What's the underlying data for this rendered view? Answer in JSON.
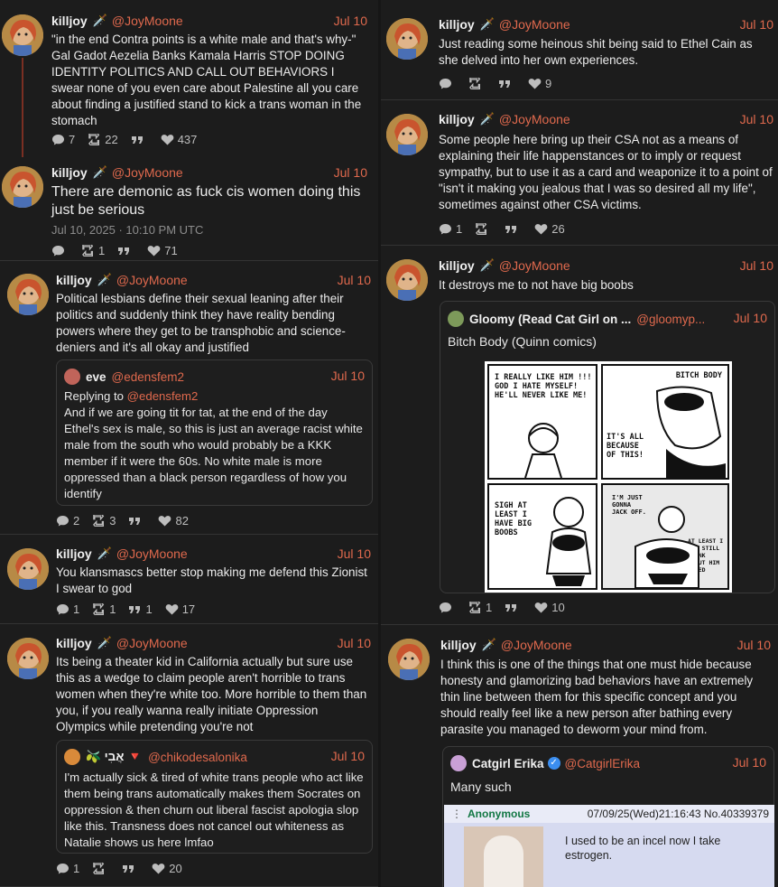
{
  "user": {
    "name": "killjoy",
    "handle": "@JoyMoone",
    "sword": "🗡️"
  },
  "left": {
    "p1": {
      "date": "Jul 10",
      "text": "\"in the end Contra points is a white male and that's why-\" Gal Gadot Aezelia Banks Kamala Harris STOP DOING IDENTITY POLITICS AND CALL OUT BEHAVIORS I swear none of you even care about Palestine all you care about finding a justified stand to kick a trans woman in the stomach",
      "replies": "7",
      "reposts": "22",
      "quotes": "",
      "likes": "437"
    },
    "p2": {
      "date": "Jul 10",
      "text": "There are demonic as fuck cis women doing this just be serious",
      "timestamp": "Jul 10, 2025 · 10:10 PM UTC",
      "replies": "",
      "reposts": "1",
      "quotes": "",
      "likes": "71"
    },
    "p3": {
      "date": "Jul 10",
      "text": "Political lesbians define their sexual leaning after their politics and suddenly think they have reality bending powers where they get to be transphobic and science-deniers and it's all okay and justified",
      "quote": {
        "name": "eve",
        "handle": "@edensfem2",
        "date": "Jul 10",
        "replying_label": "Replying to",
        "replying_to": "@edensfem2",
        "text": "And if we are going tit for tat, at the end of the day Ethel's sex is male, so this is just an average racist white male from the south who would probably be a KKK member if it were the 60s. No white male is more oppressed than a black person regardless of how you identify"
      },
      "replies": "2",
      "reposts": "3",
      "quotes": "",
      "likes": "82"
    },
    "p4": {
      "date": "Jul 10",
      "text": "You klansmascs better stop making me defend this Zionist I swear to god",
      "replies": "1",
      "reposts": "1",
      "quotes": "1",
      "likes": "17"
    },
    "p5": {
      "date": "Jul 10",
      "text": "Its being a theater kid in California actually but sure use this as a wedge to claim people aren't horrible to trans women when they're white too. More horrible to them than you, if you really wanna really initiate Oppression Olympics while pretending you're not",
      "quote": {
        "name": "🫒 אֲבִי 🔻",
        "handle": "@chikodesalonika",
        "date": "Jul 10",
        "text": "I'm actually sick & tired of white trans people who act like them being trans automatically makes them Socrates on oppression & then churn out liberal fascist apologia slop like this. Transness does not cancel out whiteness as Natalie shows us here lmfao"
      },
      "replies": "1",
      "reposts": "",
      "quotes": "",
      "likes": "20"
    }
  },
  "right": {
    "p1": {
      "date": "Jul 10",
      "text": "Just reading some heinous shit being said to Ethel Cain as she delved into her own experiences.",
      "replies": "",
      "reposts": "",
      "quotes": "",
      "likes": "9"
    },
    "p2": {
      "date": "Jul 10",
      "text": "Some people here bring up their CSA not as a means of explaining their life happenstances or to imply or request sympathy, but to use it as a card and weaponize it to a point of \"isn't it making you jealous that I was so desired all my life\", sometimes against other CSA victims.",
      "replies": "1",
      "reposts": "",
      "quotes": "",
      "likes": "26"
    },
    "p3": {
      "date": "Jul 10",
      "text": "It destroys me to not have big boobs",
      "quote": {
        "name": "Gloomy (Read Cat Girl on ...",
        "handle": "@gloomyp...",
        "date": "Jul 10",
        "text": "Bitch Body (Quinn comics)"
      },
      "comic": {
        "title": "BITCH BODY",
        "bubble1": "I REALLY LIKE HIM !!! GOD I HATE MYSELF! HE'LL NEVER LIKE ME!",
        "bubble2": "IT'S ALL BECAUSE OF THIS!",
        "bubble3": "SIGH AT LEAST I HAVE BIG BOOBS",
        "bubble4": "I'M JUST GONNA JACK OFF.",
        "bubble5": "AT LEAST I CAN STILL THINK ABOUT HIM NAKED"
      },
      "replies": "",
      "reposts": "1",
      "quotes": "",
      "likes": "10"
    },
    "p4": {
      "date": "Jul 10",
      "text": "I think this is one of the things that one must hide because honesty and glamorizing bad behaviors have an extremely thin line between them for this specific concept and you should really feel like a new person after bathing every parasite you managed to deworm your mind from.",
      "quote": {
        "name": "Catgirl Erika",
        "handle": "@CatgirlErika",
        "date": "Jul 10",
        "text": "Many such"
      },
      "chan": {
        "name": "Anonymous",
        "meta": "07/09/25(Wed)21:16:43 No.40339379",
        "text": "I used to be an incel now I take estrogen."
      }
    }
  }
}
